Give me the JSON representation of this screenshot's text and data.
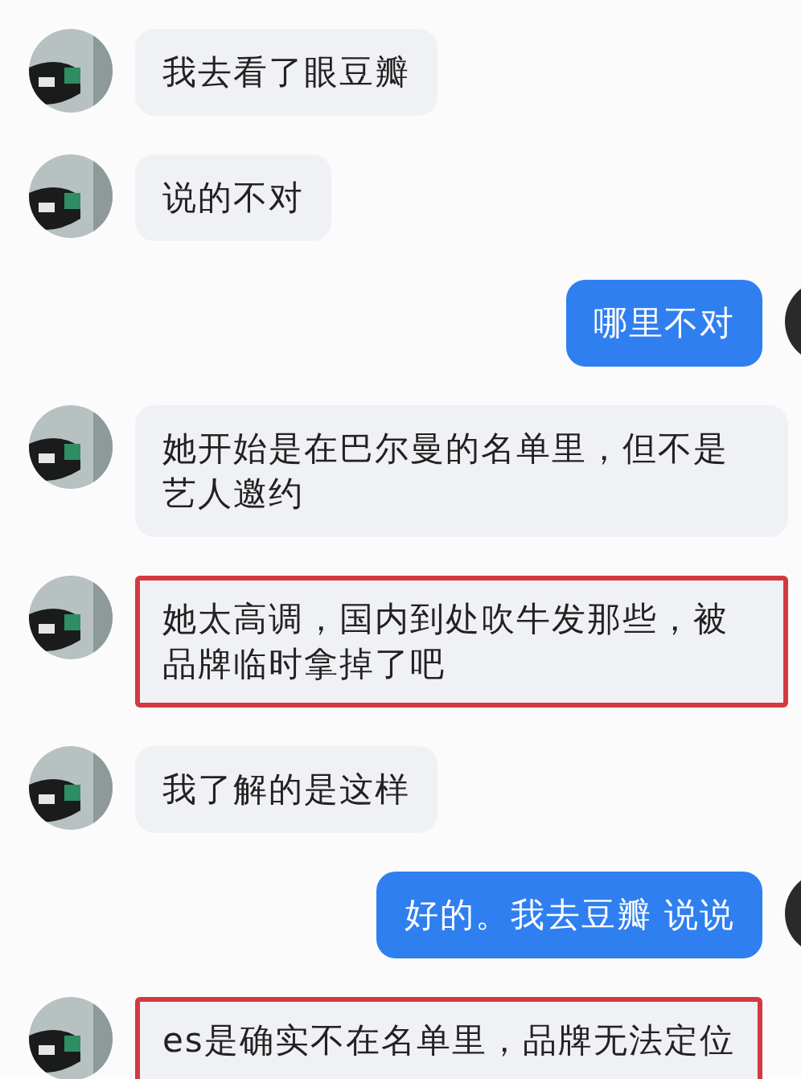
{
  "messages": [
    {
      "kind": "incoming",
      "text": "我去看了眼豆瓣",
      "highlighted": false
    },
    {
      "kind": "incoming",
      "text": "说的不对",
      "highlighted": false
    },
    {
      "kind": "outgoing",
      "text": "哪里不对",
      "highlighted": false
    },
    {
      "kind": "incoming",
      "text": "她开始是在巴尔曼的名单里，但不是艺人邀约",
      "highlighted": false
    },
    {
      "kind": "incoming",
      "text": "她太高调，国内到处吹牛发那些，被品牌临时拿掉了吧",
      "highlighted": true
    },
    {
      "kind": "incoming",
      "text": "我了解的是这样",
      "highlighted": false
    },
    {
      "kind": "outgoing",
      "text": "好的。我去豆瓣 说说",
      "highlighted": false
    },
    {
      "kind": "incoming",
      "text": "es是确实不在名单里，品牌无法定位",
      "highlighted": true
    }
  ]
}
